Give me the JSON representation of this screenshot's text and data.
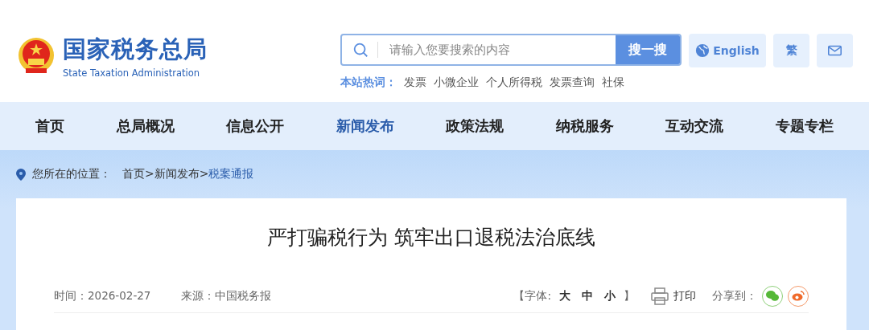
{
  "header": {
    "site_name": "国家税务总局",
    "site_name_en": "State Taxation Administration"
  },
  "search": {
    "placeholder": "请输入您要搜索的内容",
    "button": "搜一搜"
  },
  "tools": {
    "english": "English",
    "traditional": "繁"
  },
  "hot_words": {
    "label": "本站热词：",
    "items": [
      "发票",
      "小微企业",
      "个人所得税",
      "发票查询",
      "社保"
    ]
  },
  "nav": [
    {
      "label": "首页",
      "selected": false
    },
    {
      "label": "总局概况",
      "selected": false
    },
    {
      "label": "信息公开",
      "selected": false
    },
    {
      "label": "新闻发布",
      "selected": true
    },
    {
      "label": "政策法规",
      "selected": false
    },
    {
      "label": "纳税服务",
      "selected": false
    },
    {
      "label": "互动交流",
      "selected": false
    },
    {
      "label": "专题专栏",
      "selected": false
    }
  ],
  "breadcrumb": {
    "label": "您所在的位置：",
    "items": [
      {
        "text": "首页",
        "current": false
      },
      {
        "text": "新闻发布",
        "current": false
      },
      {
        "text": "税案通报",
        "current": true
      }
    ],
    "separator": ">"
  },
  "article": {
    "title": "严打骗税行为 筑牢出口退税法治底线",
    "time": "时间：2026-02-27",
    "source": "来源：中国税务报",
    "font_label_open": "【字体:",
    "font_sizes": [
      "大",
      "中",
      "小"
    ],
    "font_label_close": "】",
    "print": "打印",
    "share": "分享到："
  }
}
